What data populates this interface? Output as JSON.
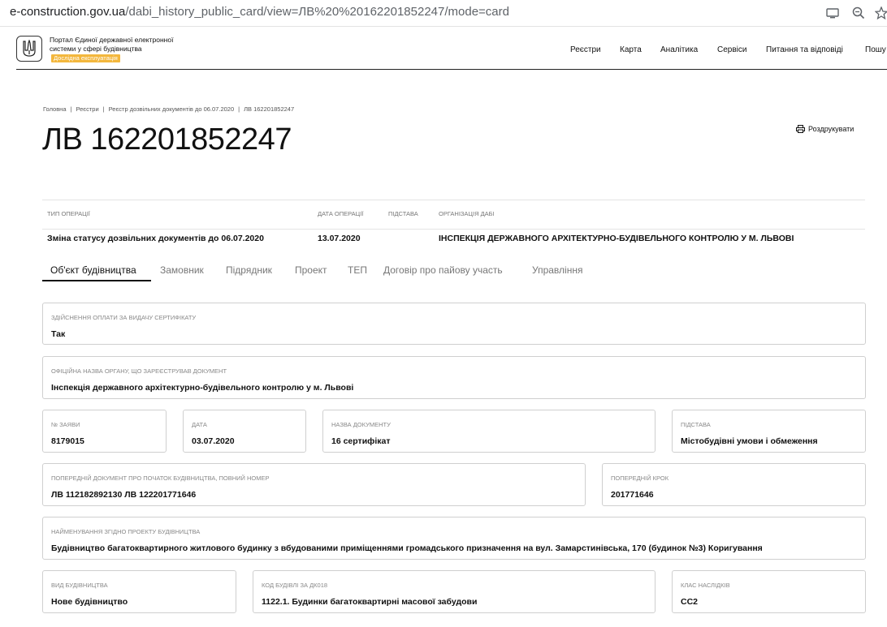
{
  "browser": {
    "url_host": "e-construction.gov.ua",
    "url_path": "/dabi_history_public_card/view=ЛВ%20%20162201852247/mode=card"
  },
  "header": {
    "portal_title": "Портал Єдиної державної електронної системи у сфері будівництва",
    "badge": "Дослідна експлуатація",
    "nav": [
      "Реєстри",
      "Карта",
      "Аналітика",
      "Сервіси",
      "Питання та відповіді",
      "Пошу"
    ]
  },
  "breadcrumb": [
    "Головна",
    "Реєстри",
    "Реєстр дозвільних документів до 06.07.2020",
    "ЛВ 162201852247"
  ],
  "page_title": "ЛВ 162201852247",
  "print_label": "Роздрукувати",
  "operations": {
    "headers": [
      "ТИП ОПЕРАЦІЇ",
      "ДАТА ОПЕРАЦІЇ",
      "ПІДСТАВА",
      "ОРГАНІЗАЦІЯ ДАБІ"
    ],
    "row": [
      "Зміна статусу дозвільних документів до 06.07.2020",
      "13.07.2020",
      "",
      "ІНСПЕКЦІЯ ДЕРЖАВНОГО АРХІТЕКТУРНО-БУДІВЕЛЬНОГО КОНТРОЛЮ У М. ЛЬВОВІ"
    ]
  },
  "tabs": [
    "Об'єкт будівництва",
    "Замовник",
    "Підрядник",
    "Проект",
    "ТЕП",
    "Договір про пайову участь",
    "Управління"
  ],
  "fields": [
    {
      "label": "ЗДІЙСНЕННЯ ОПЛАТИ ЗА ВИДАЧУ СЕРТИФІКАТУ",
      "value": "Так"
    },
    {
      "label": "ОФІЦІЙНА НАЗВА ОРГАНУ, ЩО ЗАРЕЄСТРУВАВ ДОКУМЕНТ",
      "value": "Інспекція державного архітектурно-будівельного контролю у м. Львові"
    },
    {
      "label": "№ ЗАЯВИ",
      "value": "8179015"
    },
    {
      "label": "ДАТА",
      "value": "03.07.2020"
    },
    {
      "label": "НАЗВА ДОКУМЕНТУ",
      "value": "16 сертифікат"
    },
    {
      "label": "ПІДСТАВА",
      "value": "Містобудівні умови і обмеження"
    },
    {
      "label": "ПОПЕРЕДНІЙ ДОКУМЕНТ ПРО ПОЧАТОК БУДІВНИЦТВА, ПОВНИЙ НОМЕР",
      "value": "ЛВ 112182892130 ЛВ 122201771646"
    },
    {
      "label": "ПОПЕРЕДНІЙ КРОК",
      "value": "201771646"
    },
    {
      "label": "НАЙМЕНУВАННЯ ЗГІДНО ПРОЕКТУ БУДІВНИЦТВА",
      "value": "Будівництво багатоквартирного житлового будинку з вбудованими приміщеннями громадського призначення на вул. Замарстинівська, 170 (будинок №3) Коригування"
    },
    {
      "label": "ВИД БУДІВНИЦТВА",
      "value": "Нове будівництво"
    },
    {
      "label": "КОД БУДІВЛІ ЗА ДК018",
      "value": "1122.1. Будинки багатоквартирні масової забудови"
    },
    {
      "label": "КЛАС НАСЛІДКІВ",
      "value": "СС2"
    }
  ]
}
